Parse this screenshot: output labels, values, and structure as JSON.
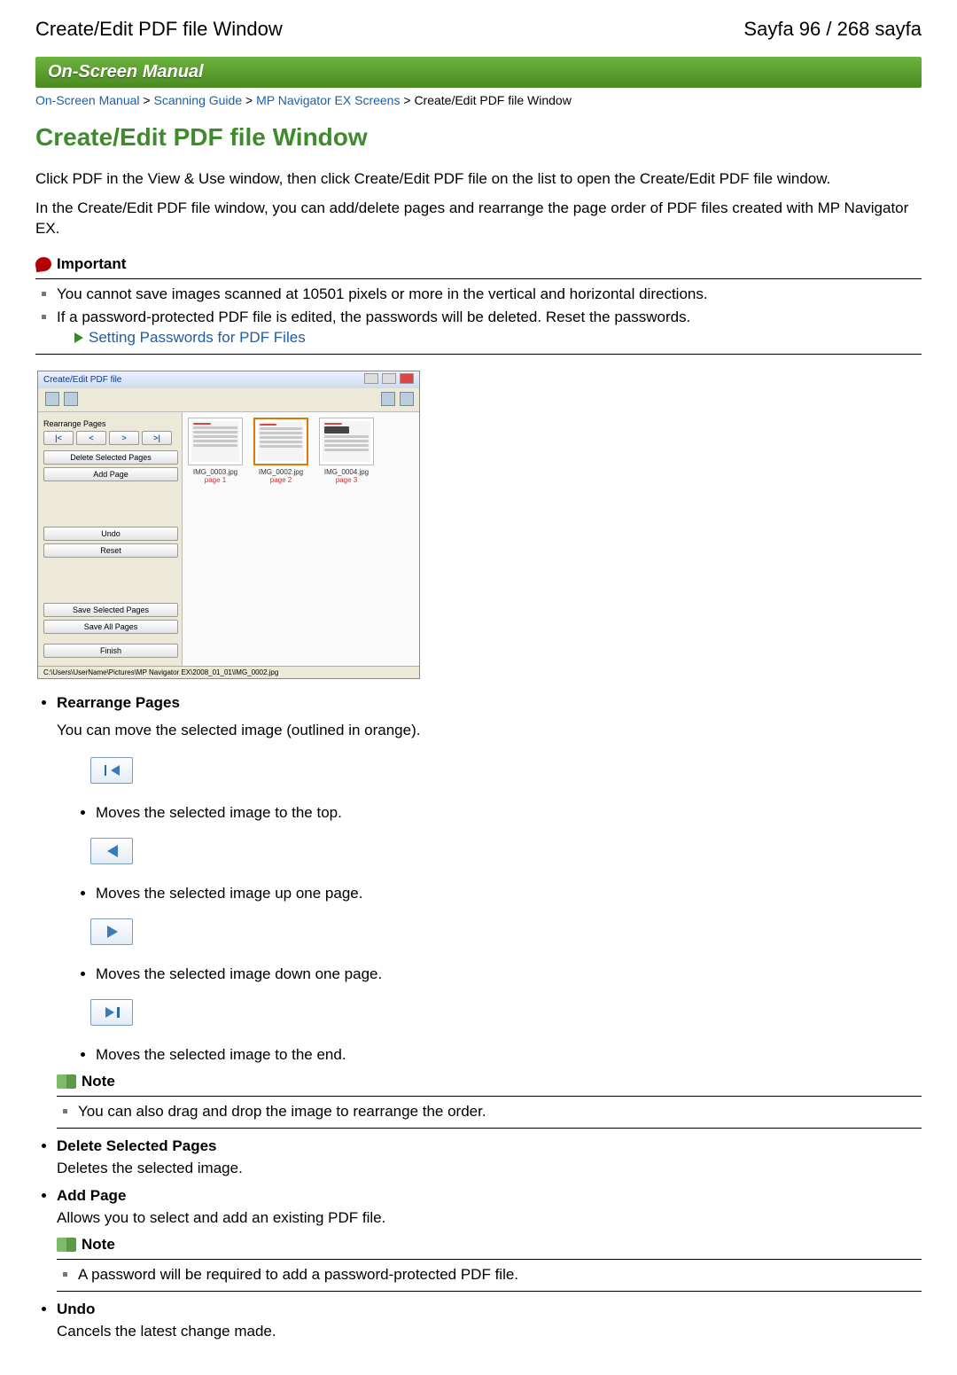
{
  "header": {
    "left": "Create/Edit PDF file Window",
    "right": "Sayfa 96 / 268 sayfa"
  },
  "banner": "On-Screen Manual",
  "breadcrumbs": {
    "crumb1": "On-Screen Manual",
    "crumb2": "Scanning Guide",
    "crumb3": "MP Navigator EX Screens",
    "crumb4": "Create/Edit PDF file Window"
  },
  "title": "Create/Edit PDF file Window",
  "intro1": "Click PDF in the View & Use window, then click Create/Edit PDF file on the list to open the Create/Edit PDF file window.",
  "intro2": "In the Create/Edit PDF file window, you can add/delete pages and rearrange the page order of PDF files created with MP Navigator EX.",
  "important": {
    "label": "Important",
    "item1": "You cannot save images scanned at 10501 pixels or more in the vertical and horizontal directions.",
    "item2": "If a password-protected PDF file is edited, the passwords will be deleted. Reset the passwords.",
    "link": "Setting Passwords for PDF Files"
  },
  "screenshot": {
    "title": "Create/Edit PDF file",
    "rearrange_label": "Rearrange Pages",
    "btn_first": "|<",
    "btn_prev": "<",
    "btn_next": ">",
    "btn_last": ">|",
    "btn_delete": "Delete Selected Pages",
    "btn_add": "Add Page",
    "btn_undo": "Undo",
    "btn_reset": "Reset",
    "btn_save_sel": "Save Selected Pages",
    "btn_save_all": "Save All Pages",
    "btn_finish": "Finish",
    "thumb1_file": "IMG_0003.jpg",
    "thumb1_page": "page 1",
    "thumb2_file": "IMG_0002.jpg",
    "thumb2_page": "page 2",
    "thumb3_file": "IMG_0004.jpg",
    "thumb3_page": "page 3",
    "status": "C:\\Users\\UserName\\Pictures\\MP Navigator EX\\2008_01_01\\IMG_0002.jpg"
  },
  "items": {
    "rearrange_title": "Rearrange Pages",
    "rearrange_desc": "You can move the selected image (outlined in orange).",
    "move_top": "Moves the selected image to the top.",
    "move_up": "Moves the selected image up one page.",
    "move_down": "Moves the selected image down one page.",
    "move_end": "Moves the selected image to the end.",
    "note_label": "Note",
    "note_drag": "You can also drag and drop the image to rearrange the order.",
    "delete_title": "Delete Selected Pages",
    "delete_desc": "Deletes the selected image.",
    "add_title": "Add Page",
    "add_desc": "Allows you to select and add an existing PDF file.",
    "note_pwd": "A password will be required to add a password-protected PDF file.",
    "undo_title": "Undo",
    "undo_desc": "Cancels the latest change made."
  }
}
